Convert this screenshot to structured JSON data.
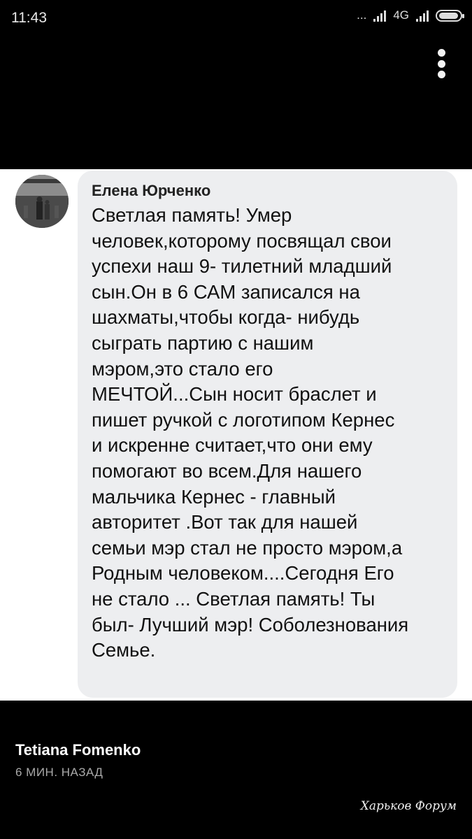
{
  "status_bar": {
    "time": "11:43",
    "ellipsis": "...",
    "network": "4G"
  },
  "post": {
    "author": "Елена Юрченко",
    "text": "Светлая память! Умер\nчеловек,которому посвящал свои\nуспехи наш 9- тилетний младший\nсын.Он в 6 САМ записался на\nшахматы,чтобы когда- нибудь\nсыграть партию с нашим\nмэром,это стало его\nМЕЧТОЙ...Сын носит браслет и\nпишет ручкой с логотипом Кернес\nи искренне считает,что они ему\nпомогают во всем.Для нашего\nмальчика Кернес - главный\nавторитет .Вот так для нашей\nсемьи мэр стал не просто мэром,а\nРодным человеком....Сегодня Его\nне стало ... Светлая память! Ты\nбыл- Лучший мэр! Соболезнования\nСемье."
  },
  "footer": {
    "name": "Tetiana Fomenko",
    "time": "6 МИН. НАЗАД"
  },
  "watermark": "Харьков Форум",
  "icons": [
    "more-vertical-icon",
    "signal-icon",
    "battery-icon",
    "avatar"
  ]
}
